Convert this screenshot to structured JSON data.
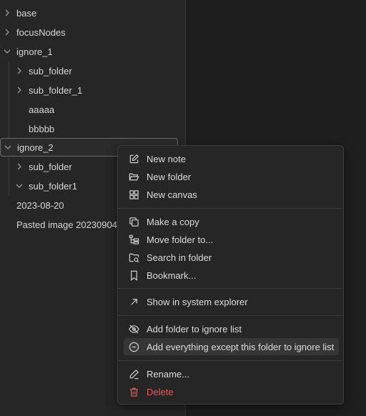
{
  "tree": {
    "items": [
      {
        "label": "base"
      },
      {
        "label": "focusNodes"
      },
      {
        "label": "ignore_1"
      },
      {
        "label": "sub_folder"
      },
      {
        "label": "sub_folder_1"
      },
      {
        "label": "aaaaa"
      },
      {
        "label": "bbbbb"
      },
      {
        "label": "ignore_2"
      },
      {
        "label": "sub_folder"
      },
      {
        "label": "sub_folder1"
      },
      {
        "label": "2023-08-20"
      },
      {
        "label": "Pasted image 20230904"
      }
    ]
  },
  "menu": {
    "items": [
      {
        "label": "New note",
        "icon": "edit-icon"
      },
      {
        "label": "New folder",
        "icon": "folder-open-icon"
      },
      {
        "label": "New canvas",
        "icon": "canvas-icon"
      },
      {
        "label": "Make a copy",
        "icon": "copy-icon"
      },
      {
        "label": "Move folder to...",
        "icon": "folder-tree-icon"
      },
      {
        "label": "Search in folder",
        "icon": "folder-search-icon"
      },
      {
        "label": "Bookmark...",
        "icon": "bookmark-icon"
      },
      {
        "label": "Show in system explorer",
        "icon": "arrow-up-right-icon"
      },
      {
        "label": "Add folder to ignore list",
        "icon": "eye-off-icon"
      },
      {
        "label": "Add everything except this folder to ignore list",
        "icon": "minus-circle-icon"
      },
      {
        "label": "Rename...",
        "icon": "pencil-icon"
      },
      {
        "label": "Delete",
        "icon": "trash-icon"
      }
    ]
  },
  "colors": {
    "danger": "#e05a5a",
    "hover": "#363636",
    "panel": "#262626"
  }
}
